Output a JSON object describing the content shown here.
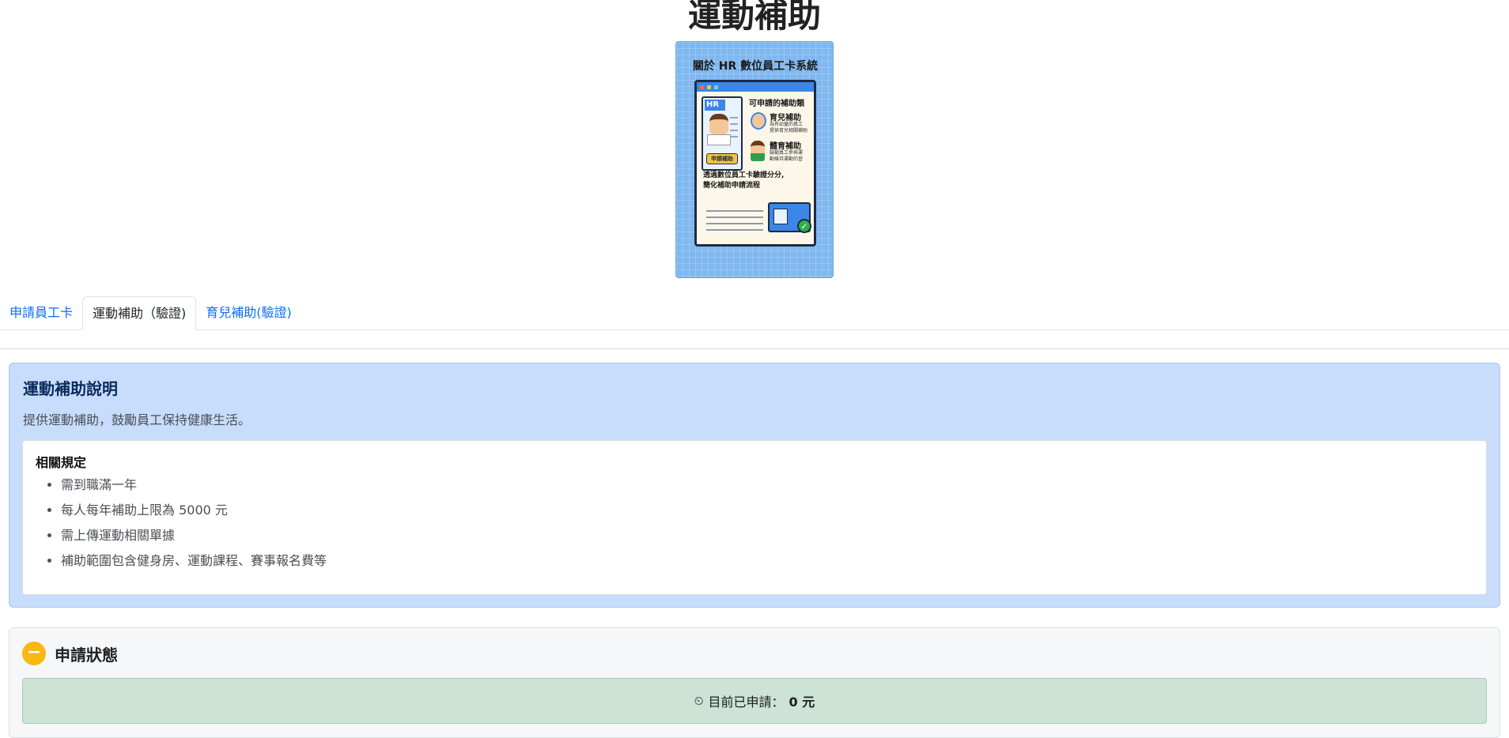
{
  "page": {
    "title": "運動補助"
  },
  "poster": {
    "heading": "關於 HR 數位員工卡系統",
    "card_badge": "HR",
    "card_button": "申請補助",
    "section_title": "可申請的補助類",
    "item1_title": "育兒補助",
    "item1_desc_line1": "為有幼童的員工",
    "item1_desc_line2": "提供育兒相關補助",
    "item2_title": "體育補助",
    "item2_desc_line1": "鼓勵員工參與運",
    "item2_desc_line2": "動維持運動的習",
    "footer_line1": "透過數位員工卡驗證分分,",
    "footer_line2": "簡化補助申請流程",
    "check_glyph": "✓"
  },
  "tabs": [
    {
      "label": "申請員工卡",
      "active": false
    },
    {
      "label": "運動補助（驗證)",
      "active": true
    },
    {
      "label": "育兒補助(驗證)",
      "active": false
    }
  ],
  "info": {
    "title": "運動補助說明",
    "description": "提供運動補助，鼓勵員工保持健康生活。",
    "rules_title": "相關規定",
    "rules": [
      "需到職滿一年",
      "每人每年補助上限為 5000 元",
      "需上傳運動相關單據",
      "補助範圍包含健身房、運動課程、賽事報名費等"
    ]
  },
  "status": {
    "title": "申請狀態",
    "icon_glyph": "−",
    "timer_glyph": "⏲",
    "label": "目前已申請：",
    "amount": "0 元"
  },
  "colors": {
    "accent": "#0d6efd",
    "info_bg": "#c8dcfb",
    "status_icon": "#fbb813",
    "status_bar_bg": "#cce3d6"
  }
}
